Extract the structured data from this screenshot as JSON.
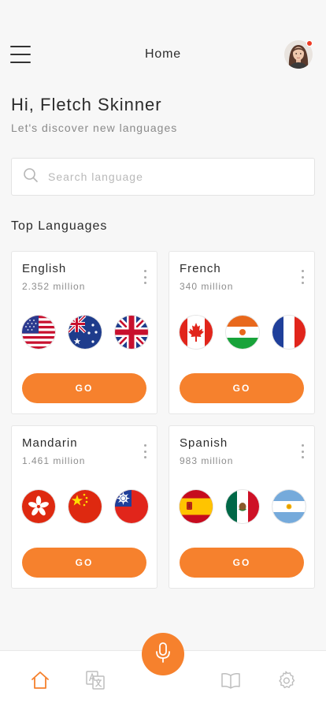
{
  "header": {
    "title": "Home",
    "menu_icon": "hamburger-icon",
    "has_notification": true
  },
  "greeting": {
    "title": "Hi, Fletch Skinner",
    "subtitle": "Let's discover new languages"
  },
  "search": {
    "placeholder": "Search language",
    "value": ""
  },
  "section_title": "Top Languages",
  "languages": [
    {
      "name": "English",
      "speakers": "2.352 million",
      "flags": [
        "usa-flag-icon",
        "australia-flag-icon",
        "uk-flag-icon"
      ],
      "button": "GO"
    },
    {
      "name": "French",
      "speakers": "340 million",
      "flags": [
        "canada-flag-icon",
        "niger-flag-icon",
        "france-flag-icon"
      ],
      "button": "GO"
    },
    {
      "name": "Mandarin",
      "speakers": "1.461 million",
      "flags": [
        "hong-kong-flag-icon",
        "china-flag-icon",
        "taiwan-flag-icon"
      ],
      "button": "GO"
    },
    {
      "name": "Spanish",
      "speakers": "983 million",
      "flags": [
        "spain-flag-icon",
        "mexico-flag-icon",
        "argentina-flag-icon"
      ],
      "button": "GO"
    }
  ],
  "tabbar": {
    "items": [
      "home-icon",
      "translate-icon",
      "microphone-icon",
      "book-icon",
      "settings-icon"
    ],
    "active": "home-icon"
  },
  "colors": {
    "accent": "#f6812d",
    "background": "#f7f7f7",
    "notification": "#ee3b24"
  }
}
